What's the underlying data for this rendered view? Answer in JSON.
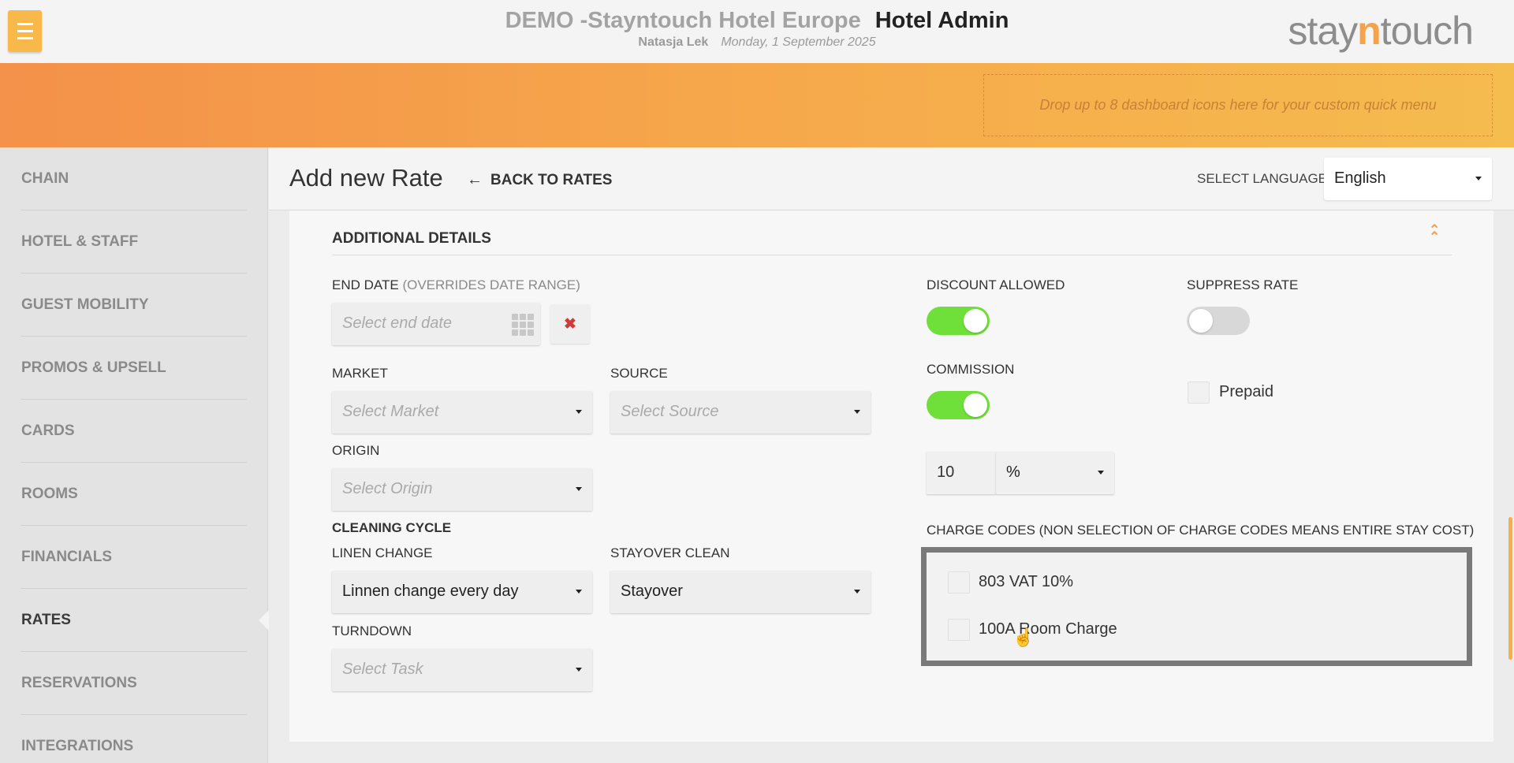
{
  "header": {
    "hotel_name": "DEMO -Stayntouch Hotel Europe",
    "app_name": "Hotel Admin",
    "user": "Natasja Lek",
    "date": "Monday, 1 September 2025",
    "logo_left": "stay",
    "logo_n": "n",
    "logo_right": "touch"
  },
  "quick_menu": {
    "placeholder": "Drop up to 8 dashboard icons here for your custom quick menu"
  },
  "sidebar": {
    "items": [
      {
        "label": "CHAIN"
      },
      {
        "label": "HOTEL & STAFF"
      },
      {
        "label": "GUEST MOBILITY"
      },
      {
        "label": "PROMOS & UPSELL"
      },
      {
        "label": "CARDS"
      },
      {
        "label": "ROOMS"
      },
      {
        "label": "FINANCIALS"
      },
      {
        "label": "RATES"
      },
      {
        "label": "RESERVATIONS"
      },
      {
        "label": "INTEGRATIONS"
      }
    ],
    "active": "RATES"
  },
  "page": {
    "title": "Add new Rate",
    "back_label": "BACK TO RATES",
    "language_label": "SELECT LANGUAGE",
    "language_value": "English"
  },
  "form": {
    "section_title": "ADDITIONAL DETAILS",
    "end_date": {
      "label": "END DATE",
      "hint": "(OVERRIDES DATE RANGE)",
      "placeholder": "Select end date"
    },
    "market": {
      "label": "MARKET",
      "placeholder": "Select Market"
    },
    "source": {
      "label": "SOURCE",
      "placeholder": "Select Source"
    },
    "origin": {
      "label": "ORIGIN",
      "placeholder": "Select Origin"
    },
    "cleaning_cycle": "CLEANING CYCLE",
    "linen_change": {
      "label": "LINEN CHANGE",
      "value": "Linnen change every day"
    },
    "stayover_clean": {
      "label": "STAYOVER CLEAN",
      "value": "Stayover"
    },
    "turndown": {
      "label": "TURNDOWN",
      "placeholder": "Select Task"
    },
    "discount_allowed": {
      "label": "DISCOUNT ALLOWED",
      "on": true
    },
    "suppress_rate": {
      "label": "SUPPRESS RATE",
      "on": false
    },
    "commission": {
      "label": "COMMISSION",
      "on": true,
      "amount": "10",
      "unit": "%"
    },
    "prepaid": {
      "label": "Prepaid",
      "checked": false
    },
    "charge_codes": {
      "label": "CHARGE CODES (NON SELECTION OF CHARGE CODES MEANS ENTIRE STAY COST)",
      "items": [
        {
          "label": "803 VAT 10%",
          "checked": false
        },
        {
          "label": "100A Room Charge",
          "checked": false
        }
      ]
    }
  },
  "colors": {
    "accent": "#f5a24a",
    "toggle_on": "#6fe039",
    "clear_red": "#d23a3a"
  }
}
